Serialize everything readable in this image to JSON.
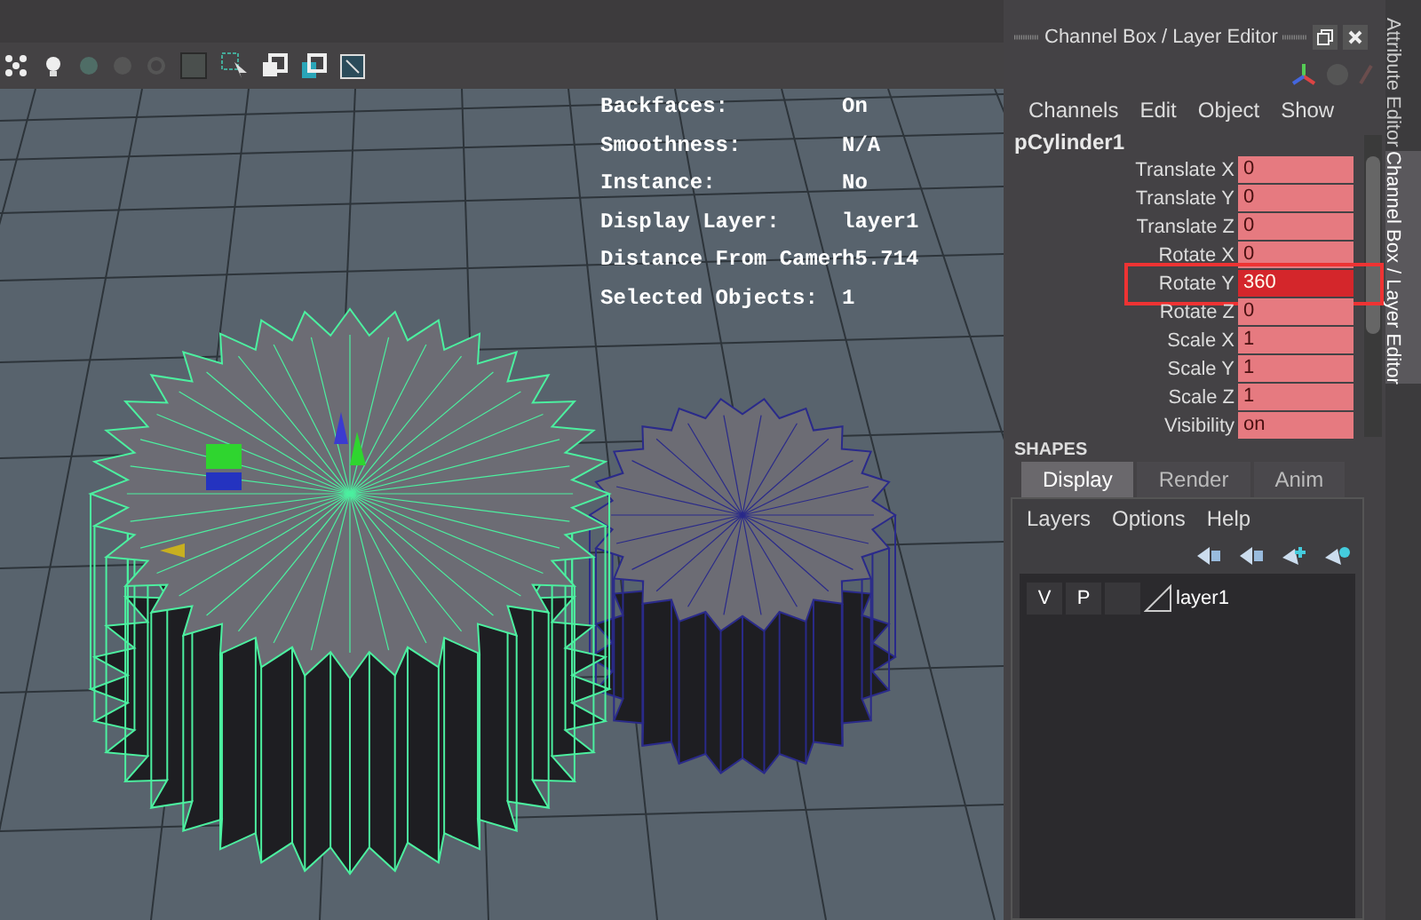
{
  "hud": [
    {
      "label": "Backfaces:",
      "value": "On"
    },
    {
      "label": "Smoothness:",
      "value": "N/A"
    },
    {
      "label": "Instance:",
      "value": "No"
    },
    {
      "label": "Display Layer:",
      "value": "layer1"
    },
    {
      "label": "Distance From Camer",
      "value": "h5.714"
    },
    {
      "label": "Selected Objects:",
      "value": "1"
    }
  ],
  "panel": {
    "title": "Channel Box / Layer Editor",
    "menu": [
      "Channels",
      "Edit",
      "Object",
      "Show"
    ],
    "object": "pCylinder1",
    "channels": [
      {
        "name": "Translate X",
        "value": "0",
        "selected": false
      },
      {
        "name": "Translate Y",
        "value": "0",
        "selected": false
      },
      {
        "name": "Translate Z",
        "value": "0",
        "selected": false
      },
      {
        "name": "Rotate X",
        "value": "0",
        "selected": false
      },
      {
        "name": "Rotate Y",
        "value": "360",
        "selected": true
      },
      {
        "name": "Rotate Z",
        "value": "0",
        "selected": false
      },
      {
        "name": "Scale X",
        "value": "1",
        "selected": false
      },
      {
        "name": "Scale Y",
        "value": "1",
        "selected": false
      },
      {
        "name": "Scale Z",
        "value": "1",
        "selected": false
      },
      {
        "name": "Visibility",
        "value": "on",
        "selected": false
      }
    ],
    "section": "SHAPES"
  },
  "layer_editor": {
    "tabs": [
      {
        "label": "Display",
        "selected": true
      },
      {
        "label": "Render",
        "selected": false
      },
      {
        "label": "Anim",
        "selected": false
      }
    ],
    "menu": [
      "Layers",
      "Options",
      "Help"
    ],
    "layers": [
      {
        "visible": "V",
        "playback": "P",
        "name": "layer1"
      }
    ]
  },
  "side_tabs": [
    {
      "label": "Attribute Editor",
      "selected": false
    },
    {
      "label": "Channel Box / Layer Editor",
      "selected": true
    }
  ]
}
